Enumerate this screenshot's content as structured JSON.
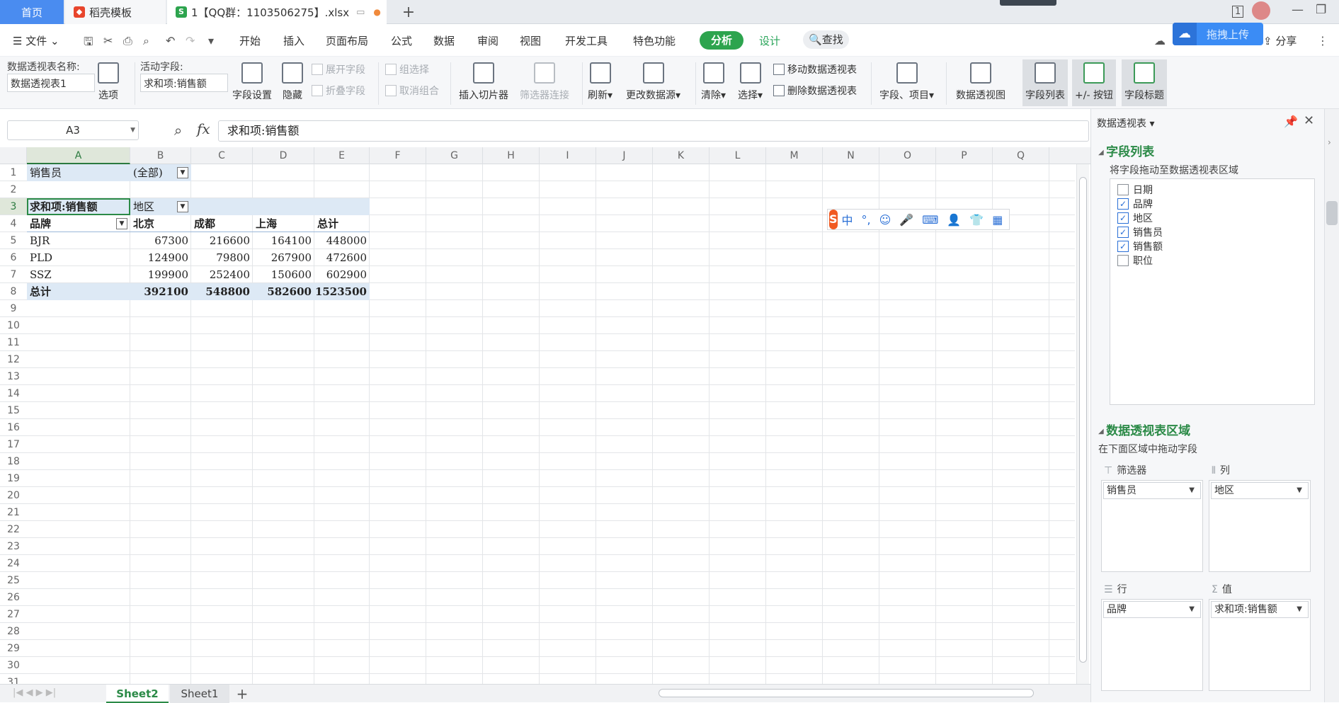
{
  "tabs": {
    "home": "首页",
    "docer": "稻壳模板",
    "file": "1【QQ群：1103506275】.xlsx",
    "file_icon": "S"
  },
  "menu": {
    "file": "文件",
    "items": [
      "开始",
      "插入",
      "页面布局",
      "公式",
      "数据",
      "审阅",
      "视图",
      "开发工具",
      "特色功能"
    ],
    "analyze": "分析",
    "design": "设计",
    "search": "查找",
    "share": "分享",
    "upload": "拖拽上传"
  },
  "ribbon": {
    "pivot_name_label": "数据透视表名称:",
    "pivot_name_value": "数据透视表1",
    "options": "选项",
    "active_field_label": "活动字段:",
    "active_field_value": "求和项:销售额",
    "field_settings": "字段设置",
    "hide": "隐藏",
    "expand_field": "展开字段",
    "collapse_field": "折叠字段",
    "group_selection": "组选择",
    "ungroup": "取消组合",
    "insert_slicer": "插入切片器",
    "filter_connections": "筛选器连接",
    "refresh": "刷新",
    "change_source": "更改数据源",
    "clear": "清除",
    "select": "选择",
    "move_pivot": "移动数据透视表",
    "delete_pivot": "删除数据透视表",
    "fields_items": "字段、项目",
    "pivot_chart": "数据透视图",
    "field_list": "字段列表",
    "plus_minus_buttons": "+/- 按钮",
    "field_headers": "字段标题"
  },
  "formula_bar": {
    "name_box": "A3",
    "fx": "fx",
    "formula": "求和项:销售额"
  },
  "grid": {
    "columns": [
      "A",
      "B",
      "C",
      "D",
      "E",
      "F",
      "G",
      "H",
      "I",
      "J",
      "K",
      "L",
      "M",
      "N",
      "O",
      "P",
      "Q"
    ],
    "rows": [
      "1",
      "2",
      "3",
      "4",
      "5",
      "6",
      "7",
      "8",
      "9",
      "10",
      "11",
      "12",
      "13",
      "14",
      "15",
      "16",
      "17",
      "18",
      "19",
      "20",
      "21",
      "22",
      "23",
      "24",
      "25",
      "26",
      "27",
      "28",
      "29",
      "30",
      "31"
    ],
    "cells": {
      "A1": "销售员",
      "B1": "(全部)",
      "A3": "求和项:销售额",
      "B3": "地区",
      "A4": "品牌",
      "B4": "北京",
      "C4": "成都",
      "D4": "上海",
      "E4": "总计",
      "A5": "BJR",
      "B5": "67300",
      "C5": "216600",
      "D5": "164100",
      "E5": "448000",
      "A6": "PLD",
      "B6": "124900",
      "C6": "79800",
      "D6": "267900",
      "E6": "472600",
      "A7": "SSZ",
      "B7": "199900",
      "C7": "252400",
      "D7": "150600",
      "E7": "602900",
      "A8": "总计",
      "B8": "392100",
      "C8": "548800",
      "D8": "582600",
      "E8": "1523500"
    }
  },
  "ime": {
    "chinese": "中",
    "punct": "°,"
  },
  "sheets": {
    "active": "Sheet2",
    "other": "Sheet1",
    "add": "+"
  },
  "panel": {
    "title": "数据透视表",
    "field_list_header": "字段列表",
    "field_list_hint": "将字段拖动至数据透视表区域",
    "fields": [
      {
        "name": "日期",
        "checked": false
      },
      {
        "name": "品牌",
        "checked": true
      },
      {
        "name": "地区",
        "checked": true
      },
      {
        "name": "销售员",
        "checked": true
      },
      {
        "name": "销售额",
        "checked": true
      },
      {
        "name": "职位",
        "checked": false
      }
    ],
    "areas_header": "数据透视表区域",
    "areas_hint": "在下面区域中拖动字段",
    "filter_label": "筛选器",
    "filter_value": "销售员",
    "column_label": "列",
    "column_value": "地区",
    "row_label": "行",
    "row_value": "品牌",
    "value_label": "值",
    "value_value": "求和项:销售额"
  },
  "colors": {
    "accent_green": "#2b8a47",
    "analyze_pill": "#2da44e",
    "pivot_blue": "#dde9f5",
    "home_tab": "#4a8cf0"
  }
}
